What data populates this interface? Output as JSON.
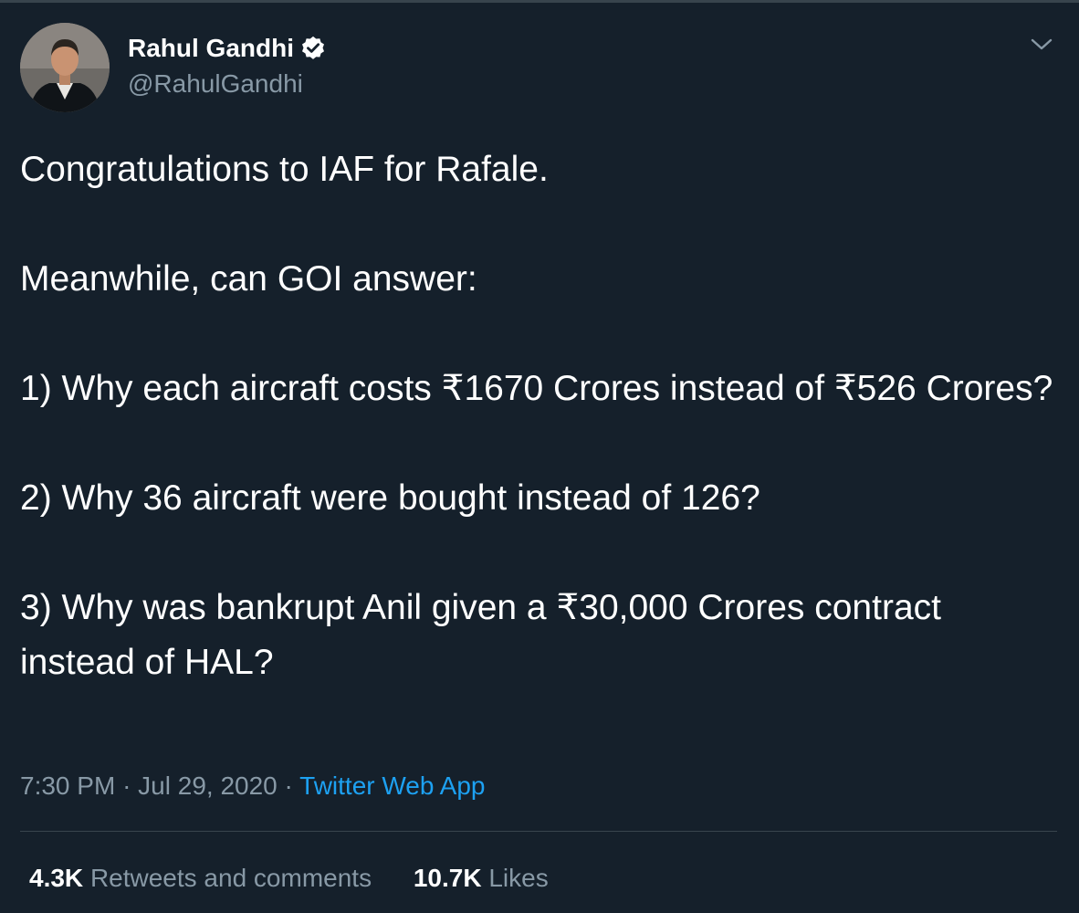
{
  "author": {
    "display_name": "Rahul Gandhi",
    "handle": "@RahulGandhi",
    "verified": true,
    "avatar_icon": "profile-photo"
  },
  "tweet": {
    "text": "Congratulations to IAF for Rafale.\n\nMeanwhile, can GOI answer:\n\n1) Why each aircraft costs ₹1670 Crores instead of ₹526 Crores?\n\n2) Why 36 aircraft were bought instead of 126?\n\n3) Why was bankrupt Anil given a ₹30,000 Crores contract instead of HAL?"
  },
  "meta": {
    "time": "7:30 PM",
    "separator": "·",
    "date": "Jul 29, 2020",
    "source": "Twitter Web App"
  },
  "stats": {
    "retweets_count": "4.3K",
    "retweets_label": "Retweets and comments",
    "likes_count": "10.7K",
    "likes_label": "Likes"
  },
  "colors": {
    "background": "#15202b",
    "secondary_text": "#8899a6",
    "link": "#1da1f2",
    "divider": "#38444d"
  }
}
